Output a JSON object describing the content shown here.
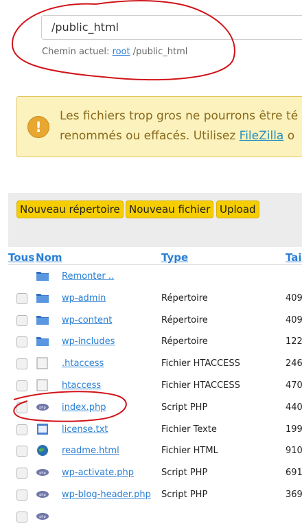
{
  "path_input": {
    "value": "/public_html"
  },
  "current_path": {
    "label": "Chemin actuel:",
    "root_link": "root",
    "suffix": "/public_html"
  },
  "warning": {
    "line1": "Les fichiers trop gros ne pourrons être té",
    "line2_before": "renommés ou effacés. Utilisez ",
    "link": "FileZilla",
    "line2_after": " o",
    "accent": "#fbf2bd"
  },
  "toolbar": {
    "new_folder": "Nouveau répertoire",
    "new_file": "Nouveau fichier",
    "upload": "Upload"
  },
  "table_header": {
    "all": "Tous",
    "name": "Nom",
    "type": "Type",
    "size": "Tai"
  },
  "files": [
    {
      "name": "Remonter ..",
      "type": "",
      "size": "",
      "icon": "folder-icon",
      "checkbox": false
    },
    {
      "name": "wp-admin",
      "type": "Répertoire",
      "size": "409",
      "icon": "folder-icon",
      "checkbox": true
    },
    {
      "name": "wp-content",
      "type": "Répertoire",
      "size": "409",
      "icon": "folder-icon",
      "checkbox": true
    },
    {
      "name": "wp-includes",
      "type": "Répertoire",
      "size": "122",
      "icon": "folder-icon",
      "checkbox": true
    },
    {
      "name": ".htaccess",
      "type": "Fichier HTACCESS",
      "size": "246",
      "icon": "file-icon",
      "checkbox": true
    },
    {
      "name": "htaccess",
      "type": "Fichier HTACCESS",
      "size": "470",
      "icon": "file-icon",
      "checkbox": true
    },
    {
      "name": "index.php",
      "type": "Script PHP",
      "size": "440",
      "icon": "php-icon",
      "checkbox": true
    },
    {
      "name": "license.txt",
      "type": "Fichier Texte",
      "size": "199",
      "icon": "text-file-icon",
      "checkbox": true
    },
    {
      "name": "readme.html",
      "type": "Fichier HTML",
      "size": "910",
      "icon": "html-globe-icon",
      "checkbox": true
    },
    {
      "name": "wp-activate.php",
      "type": "Script PHP",
      "size": "691",
      "icon": "php-icon",
      "checkbox": true
    },
    {
      "name": "wp-blog-header.php",
      "type": "Script PHP",
      "size": "369",
      "icon": "php-icon",
      "checkbox": true
    },
    {
      "name": "",
      "type": "",
      "size": "",
      "icon": "php-icon",
      "checkbox": true
    }
  ],
  "annotation_color": "#d0141a"
}
